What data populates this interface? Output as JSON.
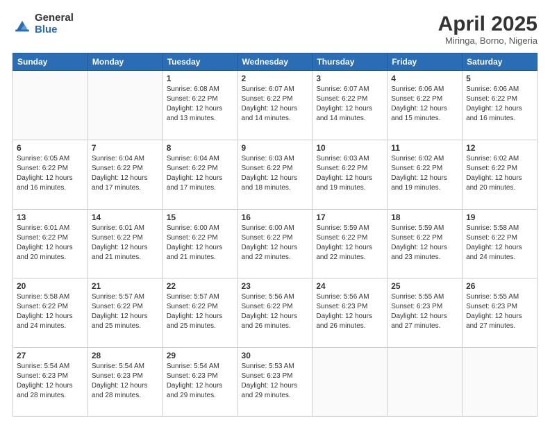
{
  "logo": {
    "general": "General",
    "blue": "Blue"
  },
  "title": "April 2025",
  "subtitle": "Miringa, Borno, Nigeria",
  "weekdays": [
    "Sunday",
    "Monday",
    "Tuesday",
    "Wednesday",
    "Thursday",
    "Friday",
    "Saturday"
  ],
  "weeks": [
    [
      {
        "day": "",
        "info": ""
      },
      {
        "day": "",
        "info": ""
      },
      {
        "day": "1",
        "info": "Sunrise: 6:08 AM\nSunset: 6:22 PM\nDaylight: 12 hours and 13 minutes."
      },
      {
        "day": "2",
        "info": "Sunrise: 6:07 AM\nSunset: 6:22 PM\nDaylight: 12 hours and 14 minutes."
      },
      {
        "day": "3",
        "info": "Sunrise: 6:07 AM\nSunset: 6:22 PM\nDaylight: 12 hours and 14 minutes."
      },
      {
        "day": "4",
        "info": "Sunrise: 6:06 AM\nSunset: 6:22 PM\nDaylight: 12 hours and 15 minutes."
      },
      {
        "day": "5",
        "info": "Sunrise: 6:06 AM\nSunset: 6:22 PM\nDaylight: 12 hours and 16 minutes."
      }
    ],
    [
      {
        "day": "6",
        "info": "Sunrise: 6:05 AM\nSunset: 6:22 PM\nDaylight: 12 hours and 16 minutes."
      },
      {
        "day": "7",
        "info": "Sunrise: 6:04 AM\nSunset: 6:22 PM\nDaylight: 12 hours and 17 minutes."
      },
      {
        "day": "8",
        "info": "Sunrise: 6:04 AM\nSunset: 6:22 PM\nDaylight: 12 hours and 17 minutes."
      },
      {
        "day": "9",
        "info": "Sunrise: 6:03 AM\nSunset: 6:22 PM\nDaylight: 12 hours and 18 minutes."
      },
      {
        "day": "10",
        "info": "Sunrise: 6:03 AM\nSunset: 6:22 PM\nDaylight: 12 hours and 19 minutes."
      },
      {
        "day": "11",
        "info": "Sunrise: 6:02 AM\nSunset: 6:22 PM\nDaylight: 12 hours and 19 minutes."
      },
      {
        "day": "12",
        "info": "Sunrise: 6:02 AM\nSunset: 6:22 PM\nDaylight: 12 hours and 20 minutes."
      }
    ],
    [
      {
        "day": "13",
        "info": "Sunrise: 6:01 AM\nSunset: 6:22 PM\nDaylight: 12 hours and 20 minutes."
      },
      {
        "day": "14",
        "info": "Sunrise: 6:01 AM\nSunset: 6:22 PM\nDaylight: 12 hours and 21 minutes."
      },
      {
        "day": "15",
        "info": "Sunrise: 6:00 AM\nSunset: 6:22 PM\nDaylight: 12 hours and 21 minutes."
      },
      {
        "day": "16",
        "info": "Sunrise: 6:00 AM\nSunset: 6:22 PM\nDaylight: 12 hours and 22 minutes."
      },
      {
        "day": "17",
        "info": "Sunrise: 5:59 AM\nSunset: 6:22 PM\nDaylight: 12 hours and 22 minutes."
      },
      {
        "day": "18",
        "info": "Sunrise: 5:59 AM\nSunset: 6:22 PM\nDaylight: 12 hours and 23 minutes."
      },
      {
        "day": "19",
        "info": "Sunrise: 5:58 AM\nSunset: 6:22 PM\nDaylight: 12 hours and 24 minutes."
      }
    ],
    [
      {
        "day": "20",
        "info": "Sunrise: 5:58 AM\nSunset: 6:22 PM\nDaylight: 12 hours and 24 minutes."
      },
      {
        "day": "21",
        "info": "Sunrise: 5:57 AM\nSunset: 6:22 PM\nDaylight: 12 hours and 25 minutes."
      },
      {
        "day": "22",
        "info": "Sunrise: 5:57 AM\nSunset: 6:22 PM\nDaylight: 12 hours and 25 minutes."
      },
      {
        "day": "23",
        "info": "Sunrise: 5:56 AM\nSunset: 6:22 PM\nDaylight: 12 hours and 26 minutes."
      },
      {
        "day": "24",
        "info": "Sunrise: 5:56 AM\nSunset: 6:23 PM\nDaylight: 12 hours and 26 minutes."
      },
      {
        "day": "25",
        "info": "Sunrise: 5:55 AM\nSunset: 6:23 PM\nDaylight: 12 hours and 27 minutes."
      },
      {
        "day": "26",
        "info": "Sunrise: 5:55 AM\nSunset: 6:23 PM\nDaylight: 12 hours and 27 minutes."
      }
    ],
    [
      {
        "day": "27",
        "info": "Sunrise: 5:54 AM\nSunset: 6:23 PM\nDaylight: 12 hours and 28 minutes."
      },
      {
        "day": "28",
        "info": "Sunrise: 5:54 AM\nSunset: 6:23 PM\nDaylight: 12 hours and 28 minutes."
      },
      {
        "day": "29",
        "info": "Sunrise: 5:54 AM\nSunset: 6:23 PM\nDaylight: 12 hours and 29 minutes."
      },
      {
        "day": "30",
        "info": "Sunrise: 5:53 AM\nSunset: 6:23 PM\nDaylight: 12 hours and 29 minutes."
      },
      {
        "day": "",
        "info": ""
      },
      {
        "day": "",
        "info": ""
      },
      {
        "day": "",
        "info": ""
      }
    ]
  ]
}
